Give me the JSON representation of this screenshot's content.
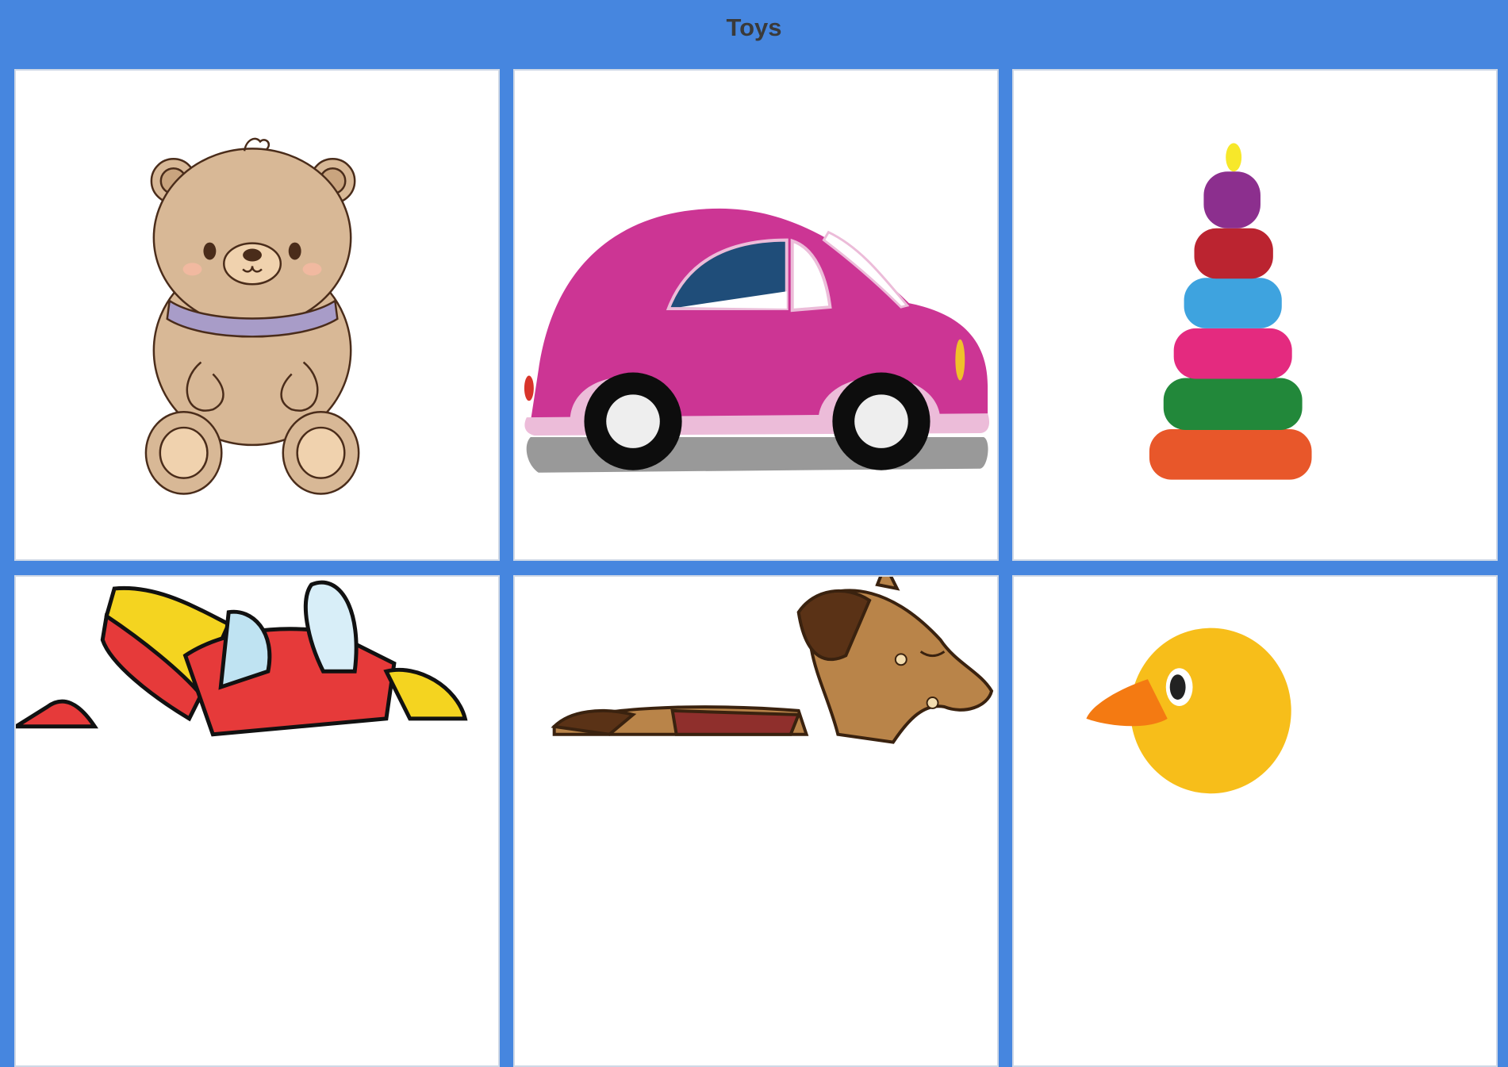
{
  "page": {
    "title": "Toys"
  },
  "toys": [
    {
      "icon": "teddy-bear-icon"
    },
    {
      "icon": "pink-car-icon"
    },
    {
      "icon": "stacking-rings-icon"
    },
    {
      "icon": "toy-airplane-icon"
    },
    {
      "icon": "rocking-horse-icon"
    },
    {
      "icon": "rubber-duck-icon"
    }
  ],
  "colors": {
    "background": "#4686df",
    "card": "#ffffff",
    "title": "#3a3a3a"
  }
}
